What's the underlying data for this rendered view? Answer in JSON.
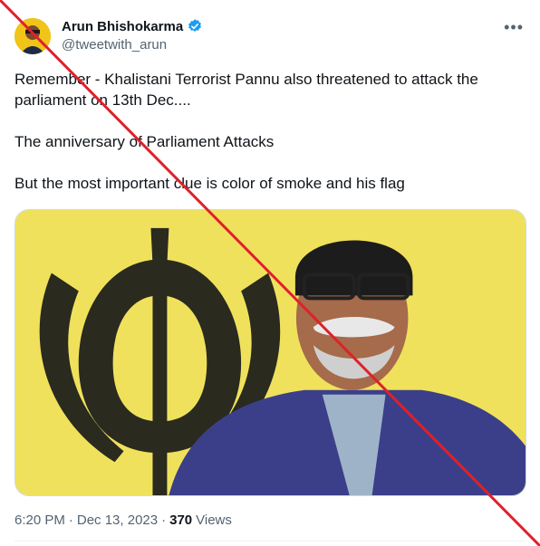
{
  "author": {
    "display_name": "Arun Bhishokarma",
    "handle": "@tweetwith_arun",
    "verified": true,
    "avatar_icon": "profile-avatar"
  },
  "menu": {
    "more_label": "•••"
  },
  "tweet": {
    "line1": "Remember - Khalistani Terrorist Pannu also threatened to attack the parliament on 13th Dec....",
    "line2": "The anniversary of Parliament Attacks",
    "line3": "But the most important clue is color of smoke and his flag"
  },
  "media": {
    "description_icon": "video-still-man-in-turban-before-yellow-flag"
  },
  "meta": {
    "time": "6:20 PM",
    "sep1": "·",
    "date": "Dec 13, 2023",
    "sep2": "·",
    "views_count": "370",
    "views_label": "Views"
  },
  "overlay": {
    "strike_color": "#e0202a"
  },
  "colors": {
    "verified_blue": "#1d9bf0",
    "flag_yellow": "#f2e24a"
  }
}
